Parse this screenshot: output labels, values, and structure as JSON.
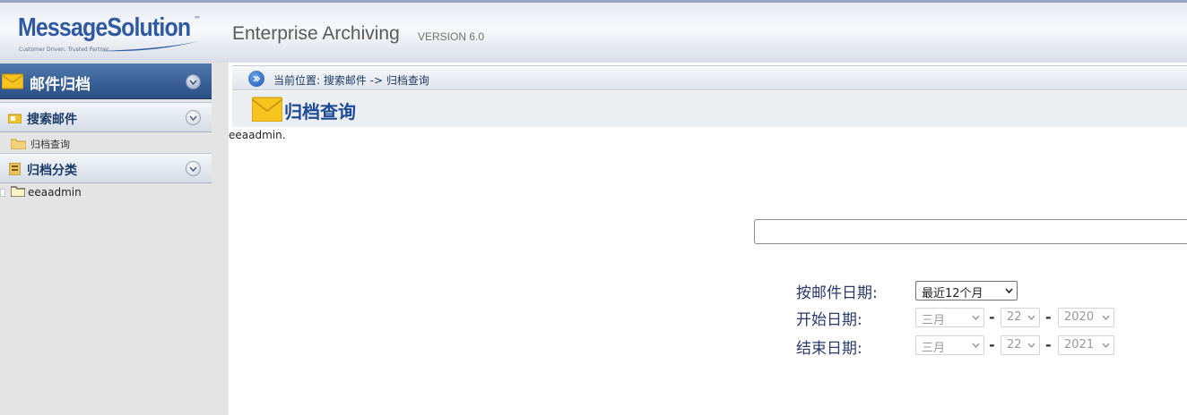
{
  "header": {
    "logo_text": "MessageSolution",
    "logo_tm": "™",
    "logo_tagline": "Customer Driven. Trusted Partner.",
    "app_title": "Enterprise Archiving",
    "version": "VERSION 6.0"
  },
  "sidebar": {
    "main_label": "邮件归档",
    "sections": [
      {
        "label": "搜索邮件",
        "items": [
          {
            "label": "归档查询"
          }
        ]
      },
      {
        "label": "归档分类"
      }
    ],
    "tree": [
      {
        "label": "eeaadmin"
      }
    ]
  },
  "breadcrumb": {
    "text": "当前位置: 搜索邮件 -> 归档查询"
  },
  "page": {
    "title": "归档查询",
    "user_note": "eeaadmin."
  },
  "search": {
    "value": ""
  },
  "form": {
    "mail_date_label": "按邮件日期:",
    "mail_date_value": "最近12个月",
    "start_label": "开始日期:",
    "end_label": "结束日期:",
    "start": {
      "month": "三月",
      "day": "22",
      "year": "2020"
    },
    "end": {
      "month": "三月",
      "day": "22",
      "year": "2021"
    }
  },
  "colors": {
    "sidebar_header": "#2a4f85",
    "title_blue": "#1d4a96",
    "label_blue": "#2a3a6a"
  }
}
